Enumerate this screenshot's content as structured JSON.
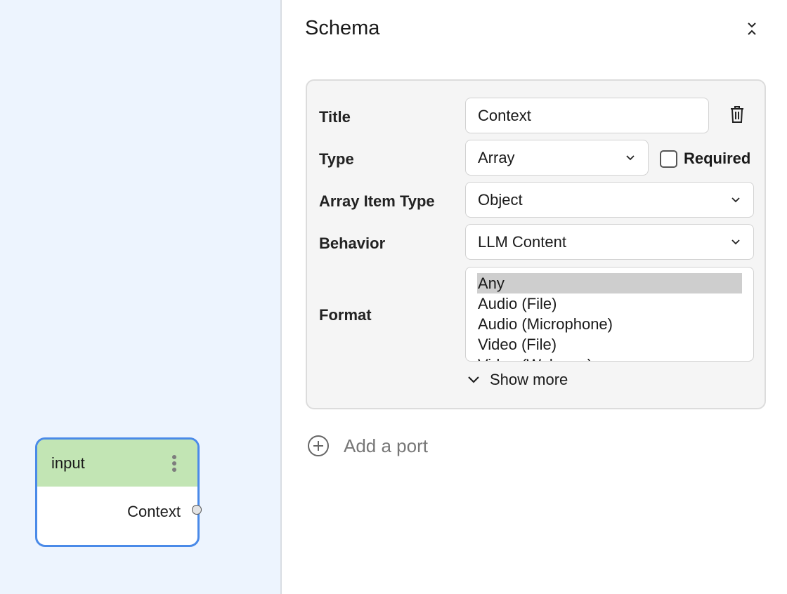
{
  "canvas": {
    "node": {
      "title": "input",
      "port_label": "Context",
      "header_color": "#c2e5b4",
      "border_color": "#4a8ae8"
    }
  },
  "panel": {
    "title": "Schema",
    "collapse_icon": "chevrons-collapse-icon",
    "fields": {
      "title_label": "Title",
      "title_value": "Context",
      "type_label": "Type",
      "type_value": "Array",
      "required_label": "Required",
      "required_checked": false,
      "array_item_type_label": "Array Item Type",
      "array_item_type_value": "Object",
      "behavior_label": "Behavior",
      "behavior_value": "LLM Content",
      "format_label": "Format",
      "format_options": [
        "Any",
        "Audio (File)",
        "Audio (Microphone)",
        "Video (File)",
        "Video (Webcam)"
      ],
      "format_selected": "Any"
    },
    "show_more": "Show more",
    "add_port": "Add a port"
  }
}
